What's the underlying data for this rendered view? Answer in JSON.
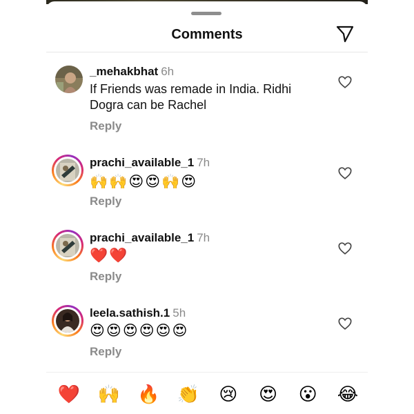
{
  "header": {
    "title": "Comments",
    "send_icon": "paper-plane-icon"
  },
  "comments": [
    {
      "username": "_mehakbhat",
      "time": "6h",
      "text": "If Friends was remade in India. Ridhi Dogra can be Rachel",
      "reply_label": "Reply",
      "has_story_ring": false
    },
    {
      "username": "prachi_available_1",
      "time": "7h",
      "emojis": [
        "🙌",
        "🙌",
        "😍",
        "😍",
        "🙌",
        "😍"
      ],
      "reply_label": "Reply",
      "has_story_ring": true
    },
    {
      "username": "prachi_available_1",
      "time": "7h",
      "emojis": [
        "❤️",
        "❤️"
      ],
      "reply_label": "Reply",
      "has_story_ring": true
    },
    {
      "username": "leela.sathish.1",
      "time": "5h",
      "emojis": [
        "😍",
        "😍",
        "😍",
        "😍",
        "😍",
        "😍"
      ],
      "reply_label": "Reply",
      "has_story_ring": true
    }
  ],
  "reactions": [
    "❤️",
    "🙌",
    "🔥",
    "👏",
    "😢",
    "😍",
    "😮",
    "😂"
  ],
  "colors": {
    "text": "#111111",
    "muted": "#8a8a8a",
    "ring_start": "#feda75",
    "ring_mid": "#d62976",
    "ring_end": "#962fbf"
  }
}
